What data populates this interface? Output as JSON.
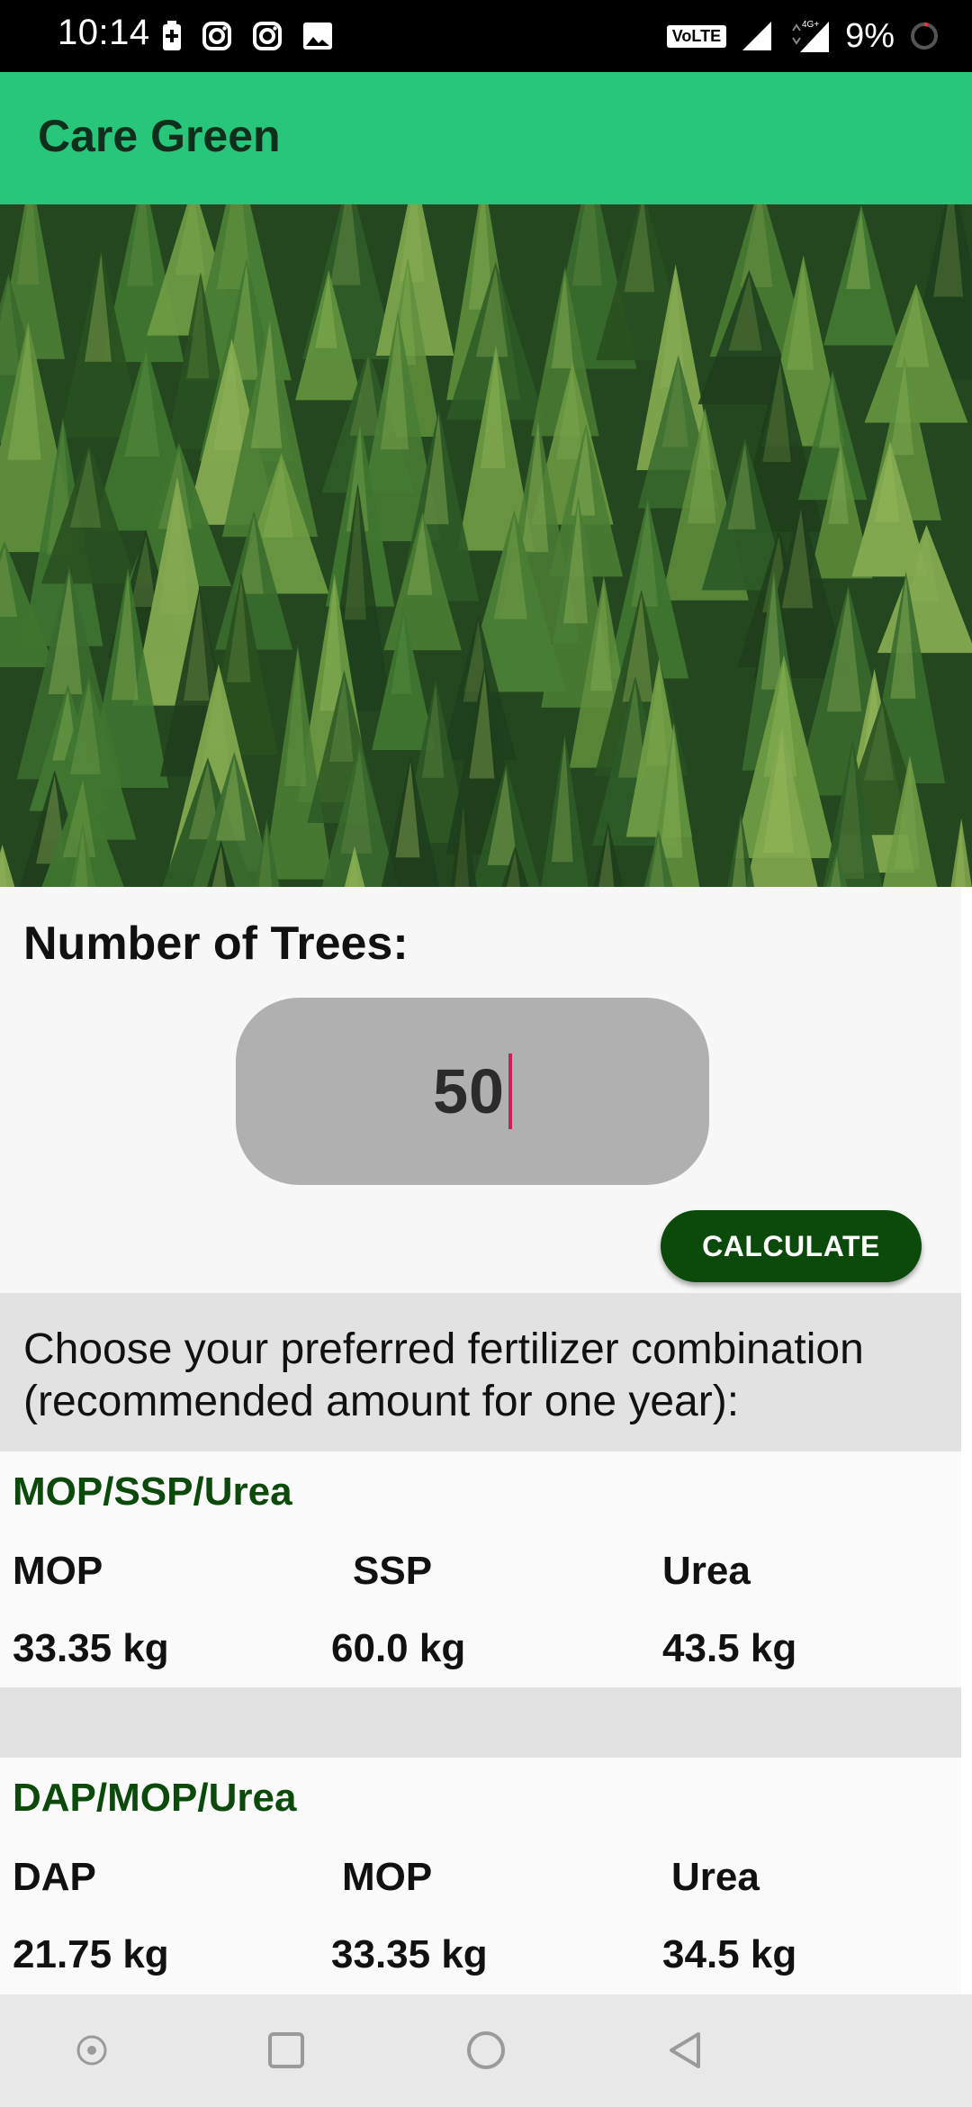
{
  "status_bar": {
    "time": "10:14",
    "left_icons": [
      "battery-saver-icon",
      "instagram-icon",
      "instagram-icon",
      "image-icon"
    ],
    "network_label": "VoLTE",
    "signal_label": "4G+",
    "battery": "9%"
  },
  "app": {
    "title": "Care Green",
    "accent_color": "#28c67a",
    "button_color": "#0b4a0b"
  },
  "trees": {
    "label": "Number of Trees:",
    "value": "50"
  },
  "calculate_label": "CALCULATE",
  "instructions": "Choose your preferred fertilizer combination (recommended amount for one year):",
  "combos": [
    {
      "title": "MOP/SSP/Urea",
      "headers": [
        "MOP",
        "SSP",
        "Urea"
      ],
      "values": [
        "33.35 kg",
        "60.0 kg",
        "43.5 kg"
      ]
    },
    {
      "title": "DAP/MOP/Urea",
      "headers": [
        "DAP",
        "MOP",
        "Urea"
      ],
      "values": [
        "21.75 kg",
        "33.35 kg",
        "34.5 kg"
      ]
    }
  ],
  "nav": [
    "screen-recorder-icon",
    "recents-icon",
    "home-icon",
    "back-icon"
  ]
}
